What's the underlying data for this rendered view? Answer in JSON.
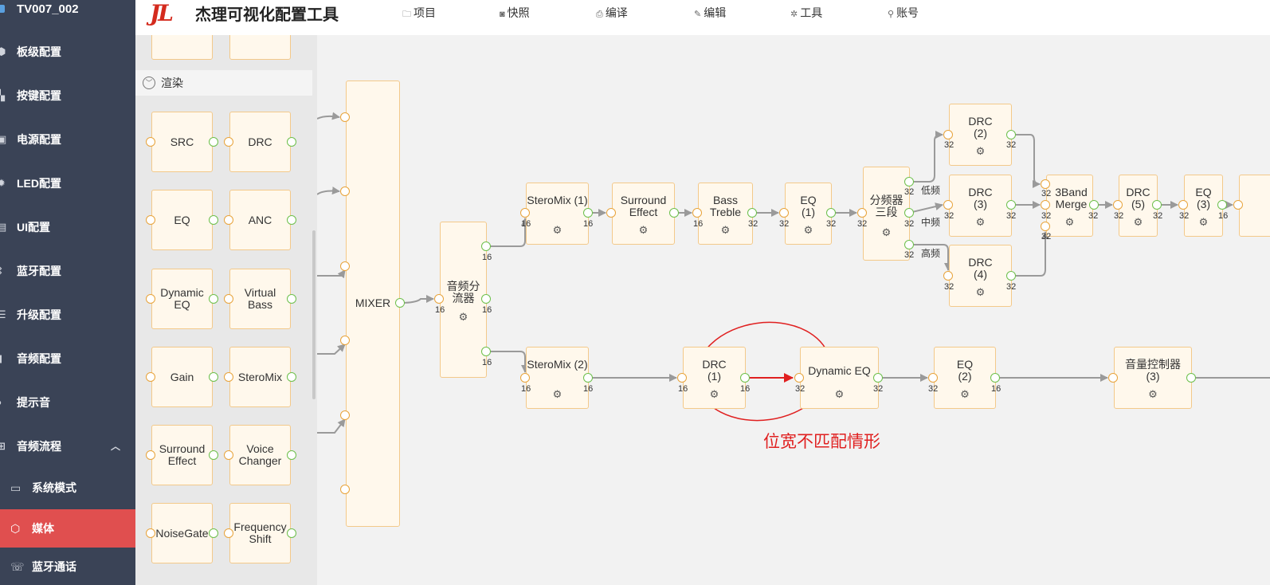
{
  "sidebar": {
    "project": "TV007_002",
    "items": [
      {
        "label": "板级配置",
        "icon": "cube-icon"
      },
      {
        "label": "按键配置",
        "icon": "keys-icon"
      },
      {
        "label": "电源配置",
        "icon": "power-icon"
      },
      {
        "label": "LED配置",
        "icon": "led-icon"
      },
      {
        "label": "UI配置",
        "icon": "ui-icon"
      },
      {
        "label": "蓝牙配置",
        "icon": "bluetooth-icon"
      },
      {
        "label": "升级配置",
        "icon": "upgrade-icon"
      },
      {
        "label": "音频配置",
        "icon": "audio-config-icon"
      },
      {
        "label": "提示音",
        "icon": "speaker-icon"
      },
      {
        "label": "音频流程",
        "icon": "flow-icon"
      }
    ],
    "sub_items": [
      {
        "label": "系统模式",
        "icon": "monitor-icon"
      },
      {
        "label": "媒体",
        "icon": "media-cube-icon"
      },
      {
        "label": "蓝牙通话",
        "icon": "bt-call-icon"
      }
    ],
    "active_sub": "媒体"
  },
  "header": {
    "logo": "JL",
    "title": "杰理可视化配置工具",
    "menu": [
      {
        "label": "项目",
        "icon": "folder-icon"
      },
      {
        "label": "快照",
        "icon": "camera-icon"
      },
      {
        "label": "编译",
        "icon": "printer-icon"
      },
      {
        "label": "编辑",
        "icon": "pen-icon"
      },
      {
        "label": "工具",
        "icon": "tool-icon"
      },
      {
        "label": "账号",
        "icon": "user-icon"
      }
    ]
  },
  "palette": {
    "section": "渲染",
    "blocks": [
      "SRC",
      "DRC",
      "EQ",
      "ANC",
      "Dynamic EQ",
      "Virtual Bass",
      "Gain",
      "SteroMix",
      "Surround Effect",
      "Voice Changer",
      "NoiseGate",
      "Frequency Shift"
    ]
  },
  "canvas": {
    "nodes": {
      "mixer": {
        "label": "MIXER"
      },
      "splitter": {
        "label": "音频分流器",
        "in": "16",
        "out": [
          "16",
          "16",
          "16"
        ]
      },
      "steromix1": {
        "label": "SteroMix (1)",
        "in": "16",
        "out": "16"
      },
      "surround": {
        "label": "Surround Effect"
      },
      "bass": {
        "label": "Bass Treble",
        "in": "16",
        "out": "32"
      },
      "eq1": {
        "label": "EQ (1)",
        "in": "32",
        "out": "32"
      },
      "crossover": {
        "label": "分频器三段",
        "in": "32",
        "out": [
          "32",
          "32",
          "32"
        ],
        "bands": [
          "低频",
          "中频",
          "高频"
        ]
      },
      "drc2": {
        "label": "DRC (2)",
        "in": "32",
        "out": "32"
      },
      "drc3": {
        "label": "DRC (3)",
        "in": "32",
        "out": "32"
      },
      "drc4": {
        "label": "DRC (4)",
        "in": "32",
        "out": "32"
      },
      "merge": {
        "label": "3Band Merge",
        "in": [
          "32",
          "32",
          "32"
        ],
        "out": "32"
      },
      "drc5": {
        "label": "DRC (5)",
        "in": "32",
        "out": "32"
      },
      "eq3": {
        "label": "EQ (3)",
        "in": "32",
        "out": "16"
      },
      "steromix2": {
        "label": "SteroMix (2)",
        "in": "16",
        "out": "16"
      },
      "drc1": {
        "label": "DRC (1)",
        "in": "16",
        "out": "16"
      },
      "dyneq": {
        "label": "Dynamic EQ",
        "in": "32",
        "out": "32"
      },
      "eq2": {
        "label": "EQ (2)",
        "in": "32",
        "out": "16"
      },
      "volume": {
        "label": "音量控制器 (3)"
      }
    },
    "annotation": "位宽不匹配情形",
    "colors": {
      "in_port": "#e8a33a",
      "out_port": "#6cbf4a",
      "edge": "#9a9a9a",
      "mismatch": "#e02020"
    }
  }
}
